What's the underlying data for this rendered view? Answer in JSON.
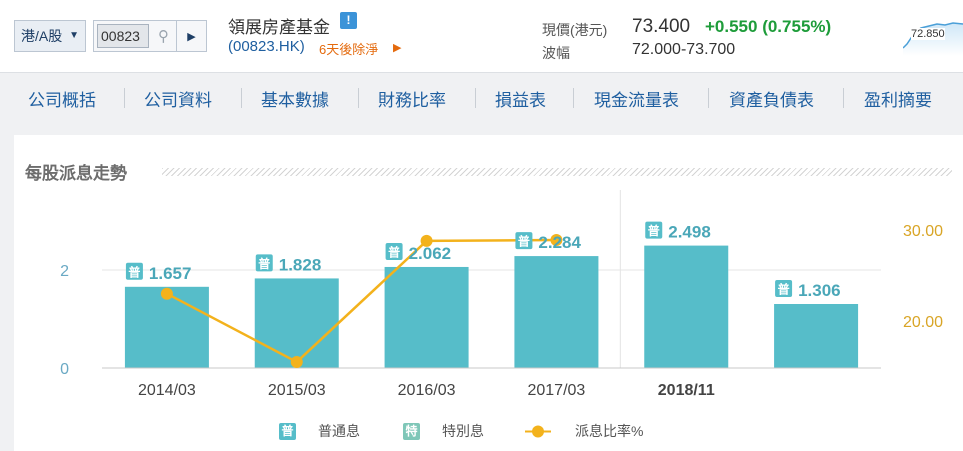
{
  "header": {
    "market_select": "港/A股",
    "stock_code_input": "00823",
    "stock_name": "領展房產基金",
    "info_icon_glyph": "!",
    "stock_symbol": "(00823.HK)",
    "dividend_note": "6天後除淨",
    "price_label": "現價(港元)",
    "price_value": "73.400",
    "price_change": "+0.550 (0.755%)",
    "range_label": "波幅",
    "range_value": "72.000-73.700",
    "mini_chart_label": "72.850"
  },
  "nav": {
    "items": [
      "公司概括",
      "公司資料",
      "基本數據",
      "財務比率",
      "損益表",
      "現金流量表",
      "資產負債表",
      "盈利摘要"
    ]
  },
  "chart_title": "每股派息走勢",
  "legend": {
    "regular_badge": "普",
    "regular_label": "普通息",
    "special_badge": "特",
    "special_label": "特別息",
    "ratio_label": "派息比率%"
  },
  "colors": {
    "bar": "#56bdc9",
    "line": "#f3b21c",
    "special": "#7fc7b8",
    "axis_right": "#d9a526",
    "up": "#1e9c3a",
    "nav_text": "#1f5fa0"
  },
  "chart_data": {
    "type": "bar",
    "categories": [
      "2014/03",
      "2015/03",
      "2016/03",
      "2017/03",
      "2018/11",
      ""
    ],
    "series": [
      {
        "values": [
          1.657,
          1.828,
          2.062,
          2.284,
          2.498,
          1.306
        ],
        "badge": "普"
      },
      {
        "type": "line",
        "axis": "right",
        "values": [
          23.0,
          15.5,
          28.8,
          28.9,
          null,
          null
        ]
      }
    ],
    "data_labels": [
      "1.657",
      "1.828",
      "2.062",
      "2.284",
      "2.498",
      "1.306"
    ],
    "y_left_ticks": [
      "0",
      "2"
    ],
    "y_left_range": [
      0,
      2.8
    ],
    "y_right_ticks": [
      "20.00",
      "30.00"
    ],
    "y_right_range": [
      14.0,
      30.0
    ],
    "grid": true,
    "legend_position": "bottom"
  }
}
